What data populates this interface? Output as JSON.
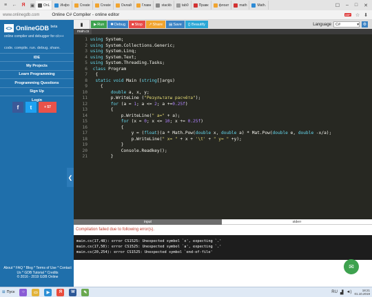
{
  "browser": {
    "tabs": [
      {
        "label": "OnL",
        "color": "#555555"
      },
      {
        "label": "Инфо",
        "color": "#2e8bd6"
      },
      {
        "label": "Create",
        "color": "#f0a430"
      },
      {
        "label": "Create",
        "color": "#f0a430"
      },
      {
        "label": "Онлай",
        "color": "#f0a430"
      },
      {
        "label": "Главн",
        "color": "#f0a430"
      },
      {
        "label": "stackb",
        "color": "#888888"
      },
      {
        "label": "tab0",
        "color": "#999999"
      },
      {
        "label": "Правк",
        "color": "#d33333"
      },
      {
        "label": "флоат",
        "color": "#f0a430"
      },
      {
        "label": "math",
        "color": "#d33333"
      },
      {
        "label": "Math.",
        "color": "#2e8bd6"
      }
    ],
    "url": "www.onlinegdb.com",
    "page_title": "Online C# Compiler - online editor",
    "ad_badge": "ABP"
  },
  "sidebar": {
    "logo": "OnlineGDB",
    "logo_beta": "beta",
    "tagline": "online compiler and debugger for c/c++",
    "slogan": "code. compile. run. debug. share.",
    "nav": [
      "IDE",
      "My Projects",
      "Learn Programming",
      "Programming Questions",
      "Sign Up",
      "Login"
    ],
    "share_count": "57",
    "footer": [
      "About * FAQ * Blog * Terms of Use * Contact",
      "Us * GDB Tutorial * Credits",
      "© 2016 - 2019 GDB Online"
    ]
  },
  "toolbar": {
    "run": "Run",
    "debug": "Debug",
    "stop": "Stop",
    "share": "Share",
    "save": "Save",
    "beautify": "{} Beautify",
    "language_label": "Language",
    "language_value": "C#"
  },
  "editor": {
    "file_tab": "main.cs",
    "line_numbers": [
      "1",
      "2",
      "3",
      "4",
      "5",
      "6",
      "7",
      "8",
      "9",
      "10",
      "11",
      "12",
      "13",
      "14",
      "15",
      "16",
      "17",
      "18",
      "19",
      "20",
      "21"
    ]
  },
  "io": {
    "input_tab": "input",
    "stderr_tab": "stderr",
    "error_title": "Compilation failed due to following error(s).",
    "errors": [
      "main.cs(17,48): error CS1525: Unexpected symbol `x', expecting `.'",
      "main.cs(17,50): error CS1525: Unexpected symbol `a', expecting `.'",
      "main.cs(20,254): error CS1525: Unexpected symbol `end-of-file'"
    ]
  },
  "taskbar": {
    "start": "Пуск",
    "time": "18:21",
    "date": "01.10.2019",
    "lang": "RU"
  }
}
